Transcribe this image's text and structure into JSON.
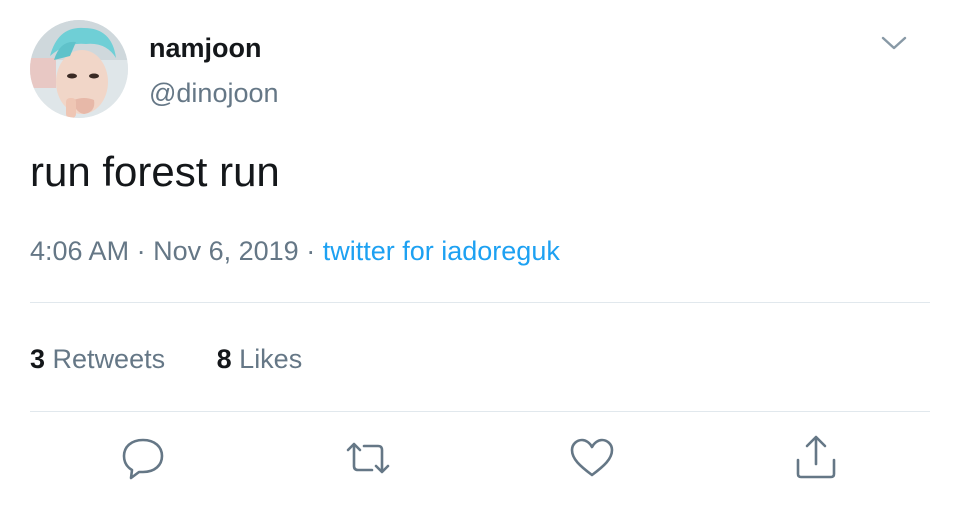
{
  "author": {
    "display_name": "namjoon",
    "handle": "@dinojoon",
    "avatar_icon": "avatar-photo"
  },
  "header": {
    "menu_icon": "chevron-down-icon"
  },
  "tweet": {
    "text": "run forest run",
    "time": "4:06 AM",
    "separator": "·",
    "date": "Nov 6, 2019",
    "source": "twitter for iadoreguk"
  },
  "stats": {
    "retweets_count": "3",
    "retweets_label": "Retweets",
    "likes_count": "8",
    "likes_label": "Likes"
  },
  "actions": {
    "reply_icon": "reply-icon",
    "retweet_icon": "retweet-icon",
    "like_icon": "heart-icon",
    "share_icon": "share-icon"
  },
  "colors": {
    "text_primary": "#14171a",
    "text_secondary": "#657786",
    "link": "#1da1f2",
    "divider": "#e1e8ed"
  }
}
